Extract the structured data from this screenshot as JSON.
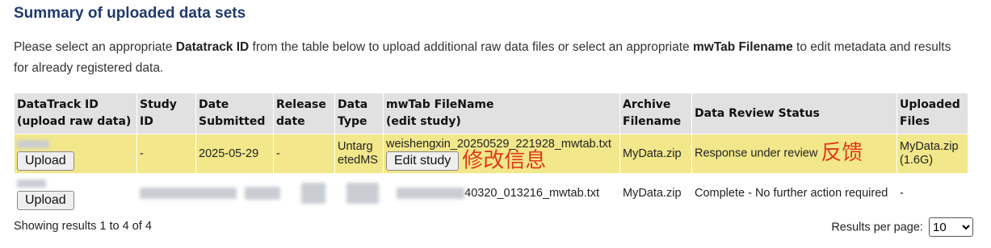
{
  "page": {
    "title": "Summary of uploaded data sets",
    "intro": {
      "p1": "Please select an appropriate ",
      "b1": "Datatrack ID",
      "p2": " from the table below to upload additional raw data files or select an appropriate ",
      "b2": "mwTab Filename",
      "p3": " to edit metadata and results for already registered data."
    }
  },
  "table": {
    "headers": {
      "datatrack_l1": "DataTrack ID",
      "datatrack_l2": "(upload raw data)",
      "study_id": "Study ID",
      "date_l1": "Date",
      "date_l2": "Submitted",
      "release_l1": "Release",
      "release_l2": "date",
      "type_l1": "Data",
      "type_l2": "Type",
      "mwtab_l1": "mwTab FileName",
      "mwtab_l2": "(edit study)",
      "archive_l1": "Archive",
      "archive_l2": "Filename",
      "review": "Data Review Status",
      "uploaded_l1": "Uploaded",
      "uploaded_l2": "Files"
    },
    "rows": [
      {
        "upload_label": "Upload",
        "study_id": "-",
        "date_submitted": "2025-05-29",
        "release_date": "-",
        "data_type_l1": "Untarg",
        "data_type_l2": "etedMS",
        "mwtab_filename": "weishengxin_20250529_221928_mwtab.txt",
        "edit_label": "Edit study",
        "edit_annotation": "修改信息",
        "archive_filename": "MyData.zip",
        "review_status": "Response under review",
        "review_annotation": "反馈",
        "uploaded_l1": "MyData.zip",
        "uploaded_l2": "(1.6G)"
      },
      {
        "upload_label": "Upload",
        "mwtab_suffix": "40320_013216_mwtab.txt",
        "archive_filename": "MyData.zip",
        "review_status": "Complete - No further action required",
        "uploaded": "-"
      }
    ]
  },
  "footer": {
    "showing": "Showing results 1 to 4 of 4",
    "per_page_label": "Results per page:",
    "per_page_value": "10"
  },
  "colors": {
    "title": "#1f3a6b",
    "header_bg": "#e1e1e1",
    "highlight_row": "#f2e78a",
    "annotation": "#e03a18"
  }
}
